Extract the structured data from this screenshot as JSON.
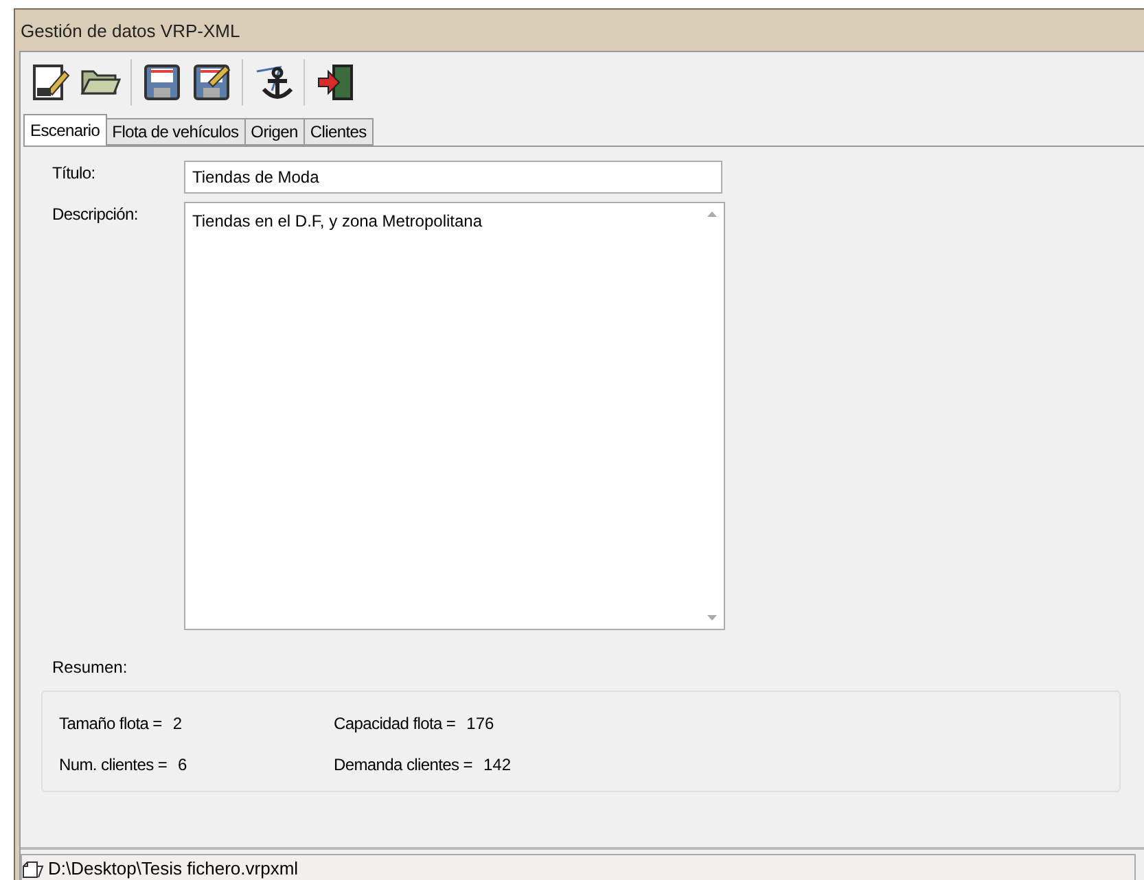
{
  "window": {
    "title": "Gestión de datos VRP-XML"
  },
  "tabs": [
    {
      "label": "Escenario",
      "selected": true
    },
    {
      "label": "Flota de vehículos",
      "selected": false
    },
    {
      "label": "Origen",
      "selected": false
    },
    {
      "label": "Clientes",
      "selected": false
    }
  ],
  "form": {
    "title_label": "Título:",
    "title_value": "Tiendas de Moda",
    "description_label": "Descripción:",
    "description_value": "Tiendas en el D.F, y zona Metropolitana"
  },
  "summary": {
    "label": "Resumen:",
    "items": [
      {
        "label": "Tamaño flota =",
        "value": "2"
      },
      {
        "label": "Capacidad flota =",
        "value": "176"
      },
      {
        "label": "Num. clientes =",
        "value": "6"
      },
      {
        "label": "Demanda clientes =",
        "value": "142"
      }
    ]
  },
  "status_bar": {
    "path": "D:\\Desktop\\Tesis fichero.vrpxml"
  }
}
